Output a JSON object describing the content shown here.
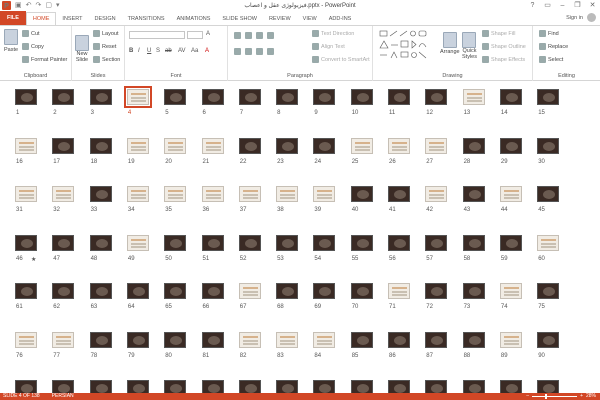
{
  "titlebar": {
    "app_logo": "P",
    "title": "فیزیولوژی عقل و اعصاب.pptx - PowerPoint",
    "qat_icons": [
      "save-icon",
      "undo-icon",
      "redo-icon",
      "start-from-beginning-icon",
      "customize-icon"
    ],
    "qat_glyphs": [
      "▣",
      "↶",
      "↷",
      "▢",
      "▾"
    ],
    "controls": {
      "help": "?",
      "display": "▭",
      "minimize": "–",
      "restore": "❐",
      "close": "✕"
    }
  },
  "tabs": {
    "items": [
      "FILE",
      "HOME",
      "INSERT",
      "DESIGN",
      "TRANSITIONS",
      "ANIMATIONS",
      "SLIDE SHOW",
      "REVIEW",
      "VIEW",
      "ADD-INS"
    ],
    "active": "HOME",
    "signin": "Sign in"
  },
  "ribbon": {
    "clipboard": {
      "label": "Clipboard",
      "paste": "Paste",
      "cut": "Cut",
      "copy": "Copy",
      "format_painter": "Format Painter"
    },
    "slides": {
      "label": "Slides",
      "new_slide": "New",
      "new_slide_2": "Slide",
      "layout": "Layout",
      "reset": "Reset",
      "section": "Section"
    },
    "font": {
      "label": "Font",
      "buttons": [
        "B",
        "I",
        "U",
        "S",
        "ab",
        "AV",
        "Aa",
        "A"
      ]
    },
    "paragraph": {
      "label": "Paragraph",
      "text_direction": "Text Direction",
      "align_text": "Align Text",
      "convert_smartart": "Convert to SmartArt"
    },
    "drawing": {
      "label": "Drawing",
      "arrange": "Arrange",
      "quick_styles": "Quick",
      "quick_styles_2": "Styles",
      "shape_fill": "Shape Fill",
      "shape_outline": "Shape Outline",
      "shape_effects": "Shape Effects"
    },
    "editing": {
      "label": "Editing",
      "find": "Find",
      "replace": "Replace",
      "select": "Select"
    }
  },
  "sorter": {
    "total_slides_visible": 90,
    "selected_slide": 4,
    "light_slides": [
      4,
      13,
      16,
      19,
      20,
      21,
      25,
      26,
      27,
      31,
      32,
      34,
      35,
      36,
      37,
      38,
      39,
      42,
      44,
      49,
      60,
      67,
      71,
      74,
      76,
      77,
      82,
      83,
      84,
      89
    ],
    "starred_slide": 46
  },
  "statusbar": {
    "slide_info": "SLIDE 4 OF 138",
    "language": "PERSIAN",
    "zoom": "28%",
    "zoom_fraction": 0.28
  }
}
